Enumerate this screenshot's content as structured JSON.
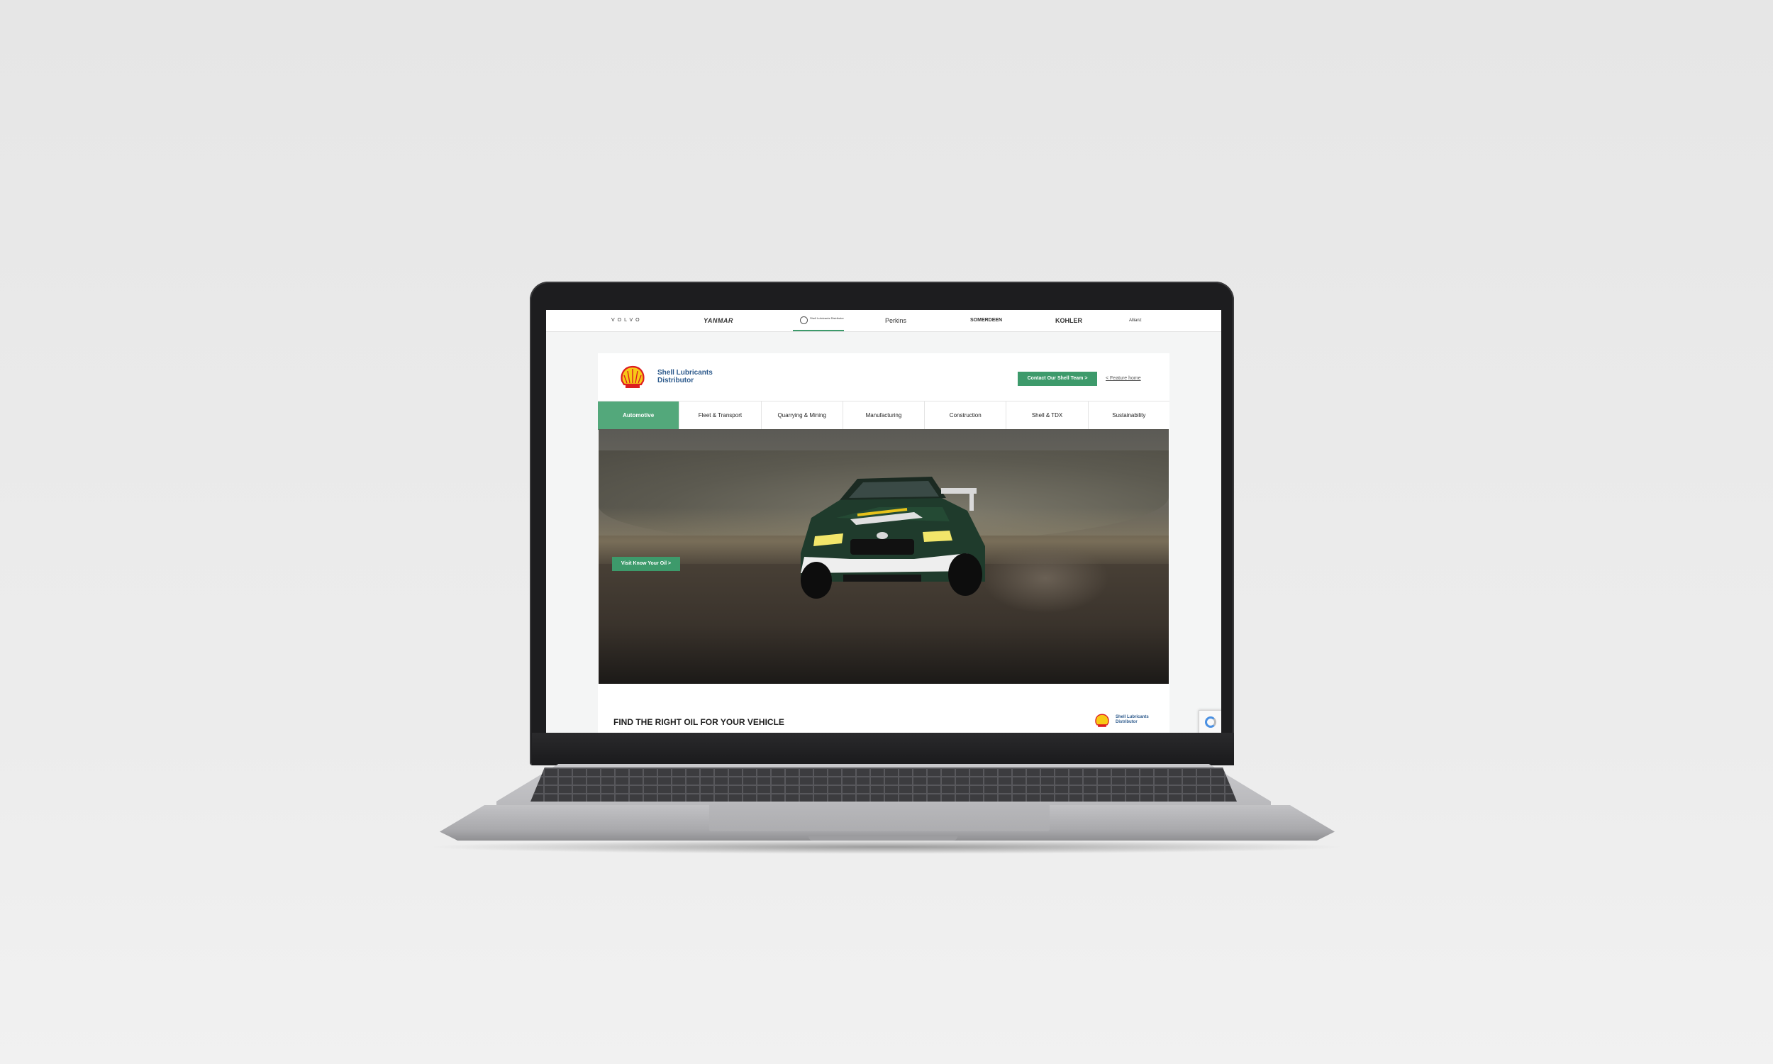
{
  "brand_bar": {
    "brands": [
      "VOLVO",
      "YANMAR",
      "Shell Lubricants Distributor",
      "Perkins",
      "SOMERDEEN",
      "KOHLER",
      "Allianz"
    ]
  },
  "header": {
    "logo_line1": "Shell Lubricants",
    "logo_line2": "Distributor",
    "contact_button": "Contact Our Shell Team  >",
    "feature_link": "< Feature home"
  },
  "tabs": [
    {
      "label": "Automotive",
      "active": true
    },
    {
      "label": "Fleet & Transport",
      "active": false
    },
    {
      "label": "Quarrying & Mining",
      "active": false
    },
    {
      "label": "Manufacturing",
      "active": false
    },
    {
      "label": "Construction",
      "active": false
    },
    {
      "label": "Shell & TDX",
      "active": false
    },
    {
      "label": "Sustainability",
      "active": false
    }
  ],
  "hero": {
    "button_label": "Visit Know Your Oil  >"
  },
  "section": {
    "heading": "FIND THE RIGHT OIL FOR YOUR VEHICLE",
    "logo_line1": "Shell Lubricants",
    "logo_line2": "Distributor"
  },
  "colors": {
    "accent_green": "#3d9a6b",
    "active_tab": "#53a87b",
    "brand_blue": "#2d5a8c",
    "shell_yellow": "#f7c916",
    "shell_red": "#dd1d21"
  }
}
